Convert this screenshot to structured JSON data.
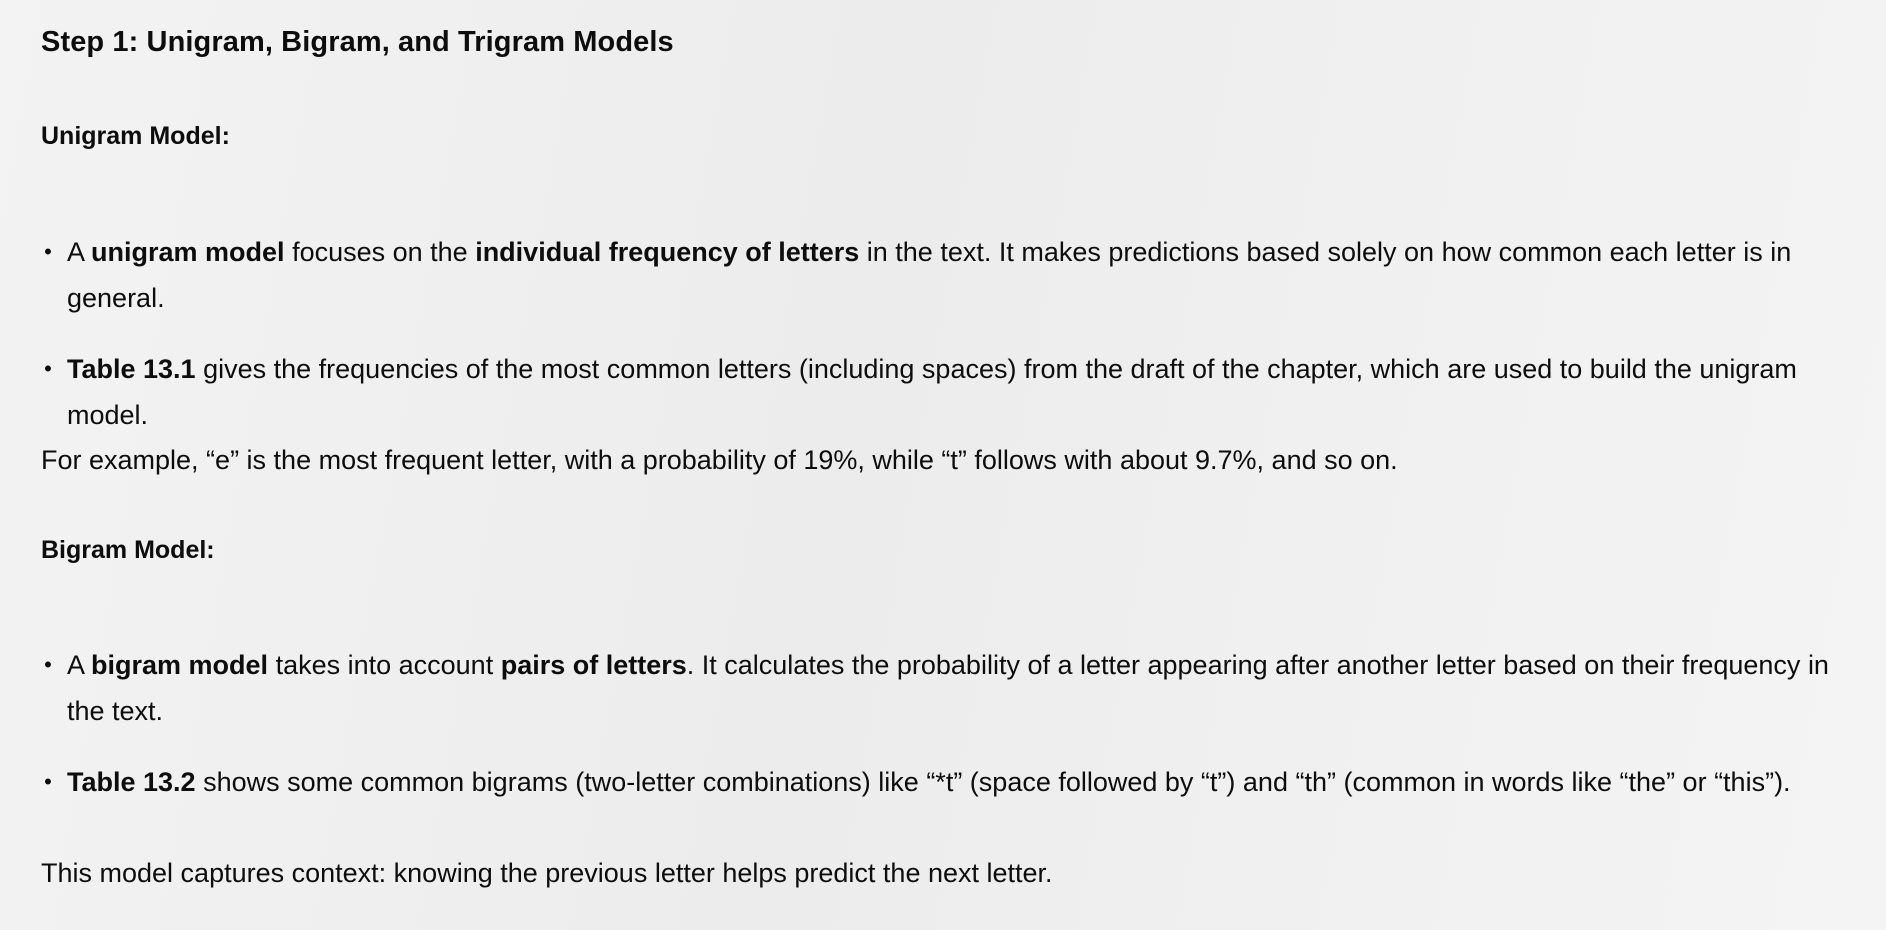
{
  "step_title": "Step 1: Unigram, Bigram, and Trigram Models",
  "unigram": {
    "heading": "Unigram Model:",
    "bullets": [
      {
        "t1": "A ",
        "b1": "unigram model",
        "t2": " focuses on the ",
        "b2": "individual frequency of letters",
        "t3": " in the text. It makes predictions based solely on how common each letter is in general."
      },
      {
        "b1": "Table 13.1",
        "t2": " gives the frequencies of the most common letters (including spaces) from the draft of the chapter, which are used to build the unigram model."
      }
    ],
    "paragraph": "For example, “e” is the most frequent letter, with a probability of 19%, while “t” follows with about 9.7%, and so on."
  },
  "bigram": {
    "heading": "Bigram Model:",
    "bullets": [
      {
        "t1": "A ",
        "b1": "bigram model",
        "t2": " takes into account ",
        "b2": "pairs of letters",
        "t3": ". It calculates the probability of a letter appearing after another letter based on their frequency in the text."
      },
      {
        "b1": "Table 13.2",
        "t2": " shows some common bigrams (two-letter combinations) like “*t” (space followed by “t”) and “th” (common in words like “the” or “this”)."
      }
    ],
    "paragraph": "This model captures context: knowing the previous letter helps predict the next letter."
  }
}
